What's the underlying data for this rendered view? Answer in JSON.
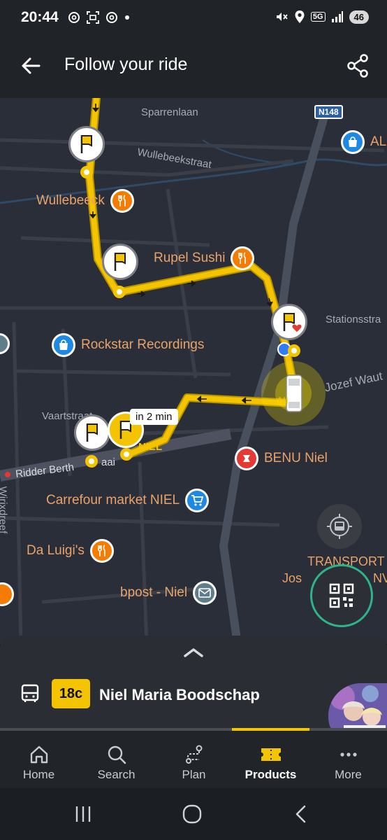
{
  "status_bar": {
    "time": "20:44",
    "network": "5G",
    "battery": "46",
    "left_icons": [
      "threads-icon",
      "screenshot-icon",
      "threads-icon",
      "dot-icon"
    ],
    "right_icons": [
      "mute-icon",
      "location-icon",
      "5g-icon",
      "signal-icon"
    ]
  },
  "appbar": {
    "title": "Follow your ride",
    "back_icon": "arrow-left-icon",
    "share_icon": "share-icon"
  },
  "map": {
    "streets": [
      "Sparrenlaan",
      "Wullebeekstraat",
      "Stationsstra",
      "Jozef Waut",
      "Vaartstraat",
      "Ridder Berth",
      "aai",
      "Wirixdreef"
    ],
    "road_badge": "N148",
    "pois": [
      {
        "label": "AL",
        "color": "#1e88e5",
        "icon": "shopping-bag-icon"
      },
      {
        "label": "Wullebeeck",
        "color": "#f57c00",
        "icon": "restaurant-icon"
      },
      {
        "label": "Rupel Sushi",
        "color": "#f57c00",
        "icon": "restaurant-icon"
      },
      {
        "label": "Rockstar Recordings",
        "color": "#1e88e5",
        "icon": "shopping-bag-icon"
      },
      {
        "label": "BENU Niel",
        "color": "#e53935",
        "icon": "pharmacy-icon"
      },
      {
        "label": "Carrefour market NIEL",
        "color": "#1e88e5",
        "icon": "cart-icon"
      },
      {
        "label": "Da Luigi's",
        "color": "#f57c00",
        "icon": "restaurant-icon"
      },
      {
        "label": "bpost - Niel",
        "color": "#607d8b",
        "icon": "mail-icon"
      }
    ],
    "niel_labels": [
      "NIEL",
      "NI"
    ],
    "eta_tag": "in 2 min",
    "transport_label_1": "TRANSPORT",
    "transport_label_2": "Jos",
    "transport_label_3": "NV",
    "route_color": "#f5c400"
  },
  "bottom_sheet": {
    "line_number": "18c",
    "destination": "Niel Maria Boodschap",
    "expand_icon": "chevron-up-icon"
  },
  "tabs": [
    {
      "label": "Home",
      "icon": "home-icon",
      "active": false
    },
    {
      "label": "Search",
      "icon": "search-icon",
      "active": false
    },
    {
      "label": "Plan",
      "icon": "route-icon",
      "active": false
    },
    {
      "label": "Products",
      "icon": "ticket-icon",
      "active": true
    },
    {
      "label": "More",
      "icon": "more-icon",
      "active": false
    }
  ],
  "system_nav": [
    "recents-icon",
    "home-circle-icon",
    "back-chevron-icon"
  ]
}
